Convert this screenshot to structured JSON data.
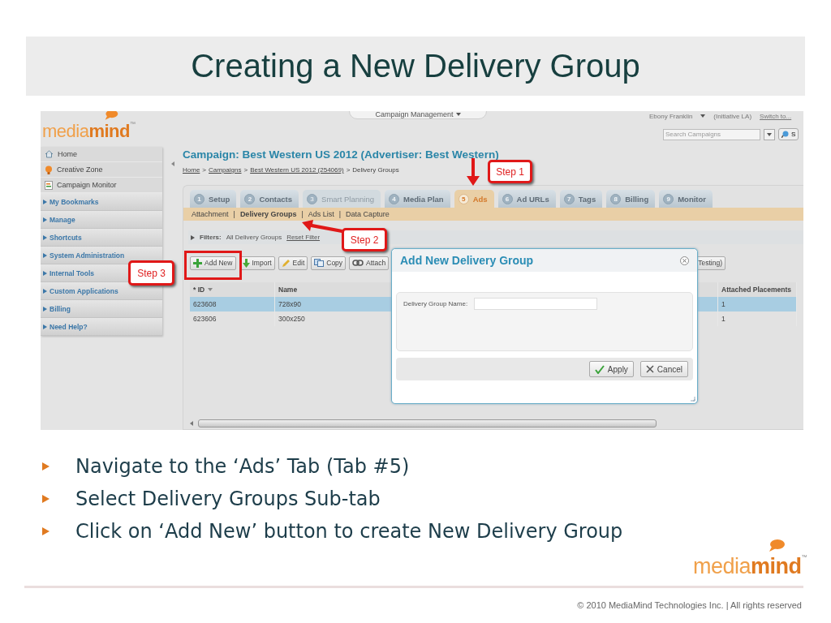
{
  "slide": {
    "title": "Creating a New Delivery Group"
  },
  "app": {
    "logo": {
      "text_1": "media",
      "text_2": "mind",
      "mark": "™"
    },
    "top_menu": {
      "label": "Campaign Management"
    },
    "user": {
      "name": "Ebony Franklin",
      "account": "(Initiative LA)",
      "switch_link": "Switch to..."
    },
    "search": {
      "placeholder": "Search Campaigns",
      "button": "S"
    },
    "sidebar": {
      "items": [
        {
          "kind": "link",
          "label": "Home"
        },
        {
          "kind": "link",
          "label": "Creative Zone"
        },
        {
          "kind": "link",
          "label": "Campaign Monitor"
        },
        {
          "kind": "section",
          "label": "My Bookmarks"
        },
        {
          "kind": "section",
          "label": "Manage"
        },
        {
          "kind": "section",
          "label": "Shortcuts"
        },
        {
          "kind": "section",
          "label": "System Administration"
        },
        {
          "kind": "section",
          "label": "Internal Tools"
        },
        {
          "kind": "section",
          "label": "Custom Applications"
        },
        {
          "kind": "section",
          "label": "Billing"
        },
        {
          "kind": "section",
          "label": "Need Help?"
        }
      ]
    },
    "campaign_title": "Campaign: Best Western US 2012 (Advertiser: Best Western)",
    "breadcrumb": {
      "separator": ">",
      "items": [
        {
          "label": "Home",
          "link": true
        },
        {
          "label": "Campaigns",
          "link": true
        },
        {
          "label": "Best Western US 2012 (254069)",
          "link": true
        },
        {
          "label": "Delivery Groups",
          "link": false
        }
      ]
    },
    "tabs": [
      {
        "number": "1",
        "label": "Setup",
        "selected": false,
        "disabled": false
      },
      {
        "number": "2",
        "label": "Contacts",
        "selected": false,
        "disabled": false
      },
      {
        "number": "3",
        "label": "Smart Planning",
        "selected": false,
        "disabled": true
      },
      {
        "number": "4",
        "label": "Media Plan",
        "selected": false,
        "disabled": false
      },
      {
        "number": "5",
        "label": "Ads",
        "selected": true,
        "disabled": false
      },
      {
        "number": "6",
        "label": "Ad URLs",
        "selected": false,
        "disabled": false
      },
      {
        "number": "7",
        "label": "Tags",
        "selected": false,
        "disabled": false
      },
      {
        "number": "8",
        "label": "Billing",
        "selected": false,
        "disabled": false
      },
      {
        "number": "9",
        "label": "Monitor",
        "selected": false,
        "disabled": false
      }
    ],
    "subtabs": {
      "separator": "|",
      "items": [
        {
          "label": "Attachment",
          "selected": false
        },
        {
          "label": "Delivery Groups",
          "selected": true
        },
        {
          "label": "Ads List",
          "selected": false
        },
        {
          "label": "Data Capture",
          "selected": false
        }
      ]
    },
    "filters": {
      "label": "Filters:",
      "value": "All Delivery Groups",
      "reset": "Reset Filter"
    },
    "toolbar": [
      {
        "label": "Add New"
      },
      {
        "label": "Import"
      },
      {
        "label": "Edit"
      },
      {
        "label": "Copy"
      },
      {
        "label": "Attach"
      }
    ],
    "toolbar_end": {
      "label": "Testing)"
    },
    "table": {
      "columns": [
        {
          "label": "* ID",
          "sorted": true
        },
        {
          "label": "Name",
          "sorted": false
        },
        {
          "label": "Attached Placements",
          "sorted": false
        }
      ],
      "rows": [
        {
          "cells": [
            "623608",
            "728x90",
            "1"
          ],
          "selected": true
        },
        {
          "cells": [
            "623606",
            "300x250",
            "1"
          ],
          "selected": false
        }
      ]
    },
    "dialog": {
      "title": "Add New Delivery Group",
      "field_label": "Delivery Group Name:",
      "buttons": [
        {
          "label": "Apply"
        },
        {
          "label": "Cancel"
        }
      ]
    }
  },
  "callouts": [
    {
      "label": "Step 1"
    },
    {
      "label": "Step 2"
    },
    {
      "label": "Step 3"
    }
  ],
  "bullets": [
    "Navigate to the ‘Ads’ Tab (Tab #5)",
    "Select Delivery Groups Sub-tab",
    "Click on ‘Add New’ button to create New Delivery Group"
  ],
  "footer": {
    "logo": {
      "text_1": "media",
      "text_2": "mind",
      "mark": "™"
    },
    "copyright": "© 2010 MediaMind Technologies Inc. | All rights reserved"
  }
}
